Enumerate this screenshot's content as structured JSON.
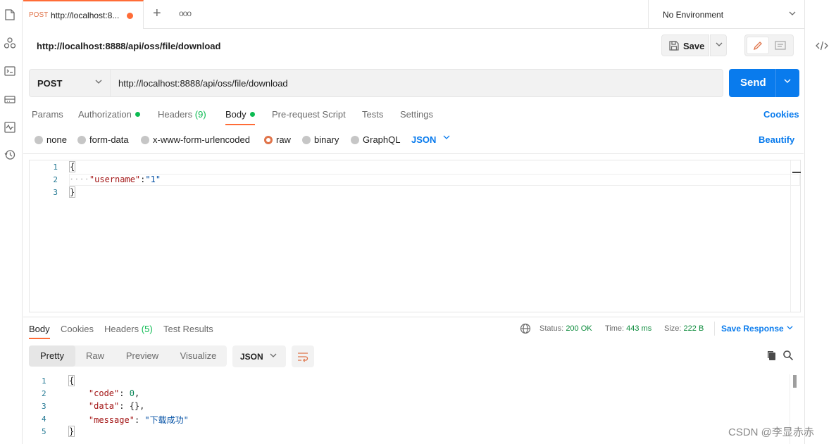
{
  "tab": {
    "method": "POST",
    "title": "http://localhost:8..."
  },
  "environment": {
    "label": "No Environment"
  },
  "request": {
    "title": "http://localhost:8888/api/oss/file/download",
    "method": "POST",
    "url": "http://localhost:8888/api/oss/file/download",
    "send_label": "Send",
    "save_label": "Save"
  },
  "request_tabs": [
    {
      "label": "Params"
    },
    {
      "label": "Authorization"
    },
    {
      "label": "Headers",
      "count": "(9)"
    },
    {
      "label": "Body"
    },
    {
      "label": "Pre-request Script"
    },
    {
      "label": "Tests"
    },
    {
      "label": "Settings"
    }
  ],
  "cookies_label": "Cookies",
  "body_types": [
    "none",
    "form-data",
    "x-www-form-urlencoded",
    "raw",
    "binary",
    "GraphQL"
  ],
  "body_format": "JSON",
  "beautify_label": "Beautify",
  "request_body": {
    "line_numbers": [
      "1",
      "2",
      "3"
    ],
    "open": "{",
    "key": "\"username\"",
    "colon": ":",
    "value": "\"1\"",
    "close": "}"
  },
  "response_tabs": [
    {
      "label": "Body"
    },
    {
      "label": "Cookies"
    },
    {
      "label": "Headers",
      "count": "(5)"
    },
    {
      "label": "Test Results"
    }
  ],
  "response_status": {
    "status_label": "Status:",
    "status_value": "200 OK",
    "time_label": "Time:",
    "time_value": "443 ms",
    "size_label": "Size:",
    "size_value": "222 B"
  },
  "save_response_label": "Save Response",
  "view_modes": [
    "Pretty",
    "Raw",
    "Preview",
    "Visualize"
  ],
  "response_format": "JSON",
  "response_body": {
    "line_numbers": [
      "1",
      "2",
      "3",
      "4",
      "5"
    ],
    "open": "{",
    "code_key": "\"code\"",
    "code_value": "0",
    "data_key": "\"data\"",
    "data_value": "{}",
    "message_key": "\"message\"",
    "message_value": "\"下载成功\"",
    "close": "}"
  },
  "watermark": "CSDN @李显赤赤",
  "colors": {
    "accent": "#ff6c37",
    "primary": "#097bed",
    "success": "#0cbb52"
  }
}
